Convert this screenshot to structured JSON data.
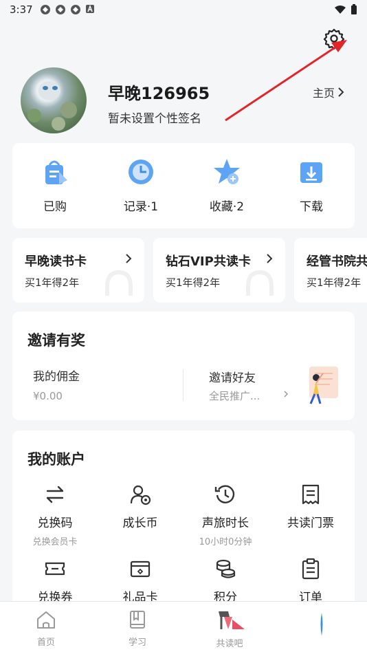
{
  "status": {
    "time": "3:37"
  },
  "profile": {
    "username": "早晚126965",
    "signature": "暂未设置个性签名",
    "home_link": "主页"
  },
  "quick_actions": [
    {
      "label": "已购",
      "icon": "shopping-bag-icon"
    },
    {
      "label": "记录·1",
      "icon": "clock-icon"
    },
    {
      "label": "收藏·2",
      "icon": "star-plus-icon"
    },
    {
      "label": "下载",
      "icon": "download-icon"
    }
  ],
  "vip_cards": [
    {
      "title": "早晚读书卡",
      "subtitle": "买1年得2年"
    },
    {
      "title": "钻石VIP共读卡",
      "subtitle": "买1年得2年"
    },
    {
      "title": "经管书院共",
      "subtitle": "买1年得2年"
    }
  ],
  "invite": {
    "title": "邀请有奖",
    "commission_label": "我的佣金",
    "commission_value": "¥0.00",
    "invite_label": "邀请好友",
    "invite_sub": "全民推广..."
  },
  "account": {
    "title": "我的账户",
    "items": [
      {
        "label": "兑换码",
        "sub": "兑换会员卡",
        "icon": "exchange-icon"
      },
      {
        "label": "成长币",
        "sub": "",
        "icon": "user-coin-icon"
      },
      {
        "label": "声旅时长",
        "sub": "10小时0分钟",
        "icon": "time-reset-icon"
      },
      {
        "label": "共读门票",
        "sub": "",
        "icon": "receipt-icon"
      },
      {
        "label": "兑换券",
        "sub": "",
        "icon": "ticket-icon"
      },
      {
        "label": "礼品卡",
        "sub": "",
        "icon": "gift-card-icon"
      },
      {
        "label": "积分",
        "sub": "",
        "icon": "coins-icon"
      },
      {
        "label": "订单",
        "sub": "",
        "icon": "clipboard-icon"
      }
    ]
  },
  "tabs": [
    {
      "label": "首页",
      "icon": "home-icon"
    },
    {
      "label": "学习",
      "icon": "book-icon"
    },
    {
      "label": "共读吧",
      "icon": "flag-icon"
    },
    {
      "label": "",
      "icon": "me-icon"
    }
  ],
  "colors": {
    "accent": "#3a8cf0",
    "annotation": "#e0262b",
    "background": "#f5f6f8"
  }
}
